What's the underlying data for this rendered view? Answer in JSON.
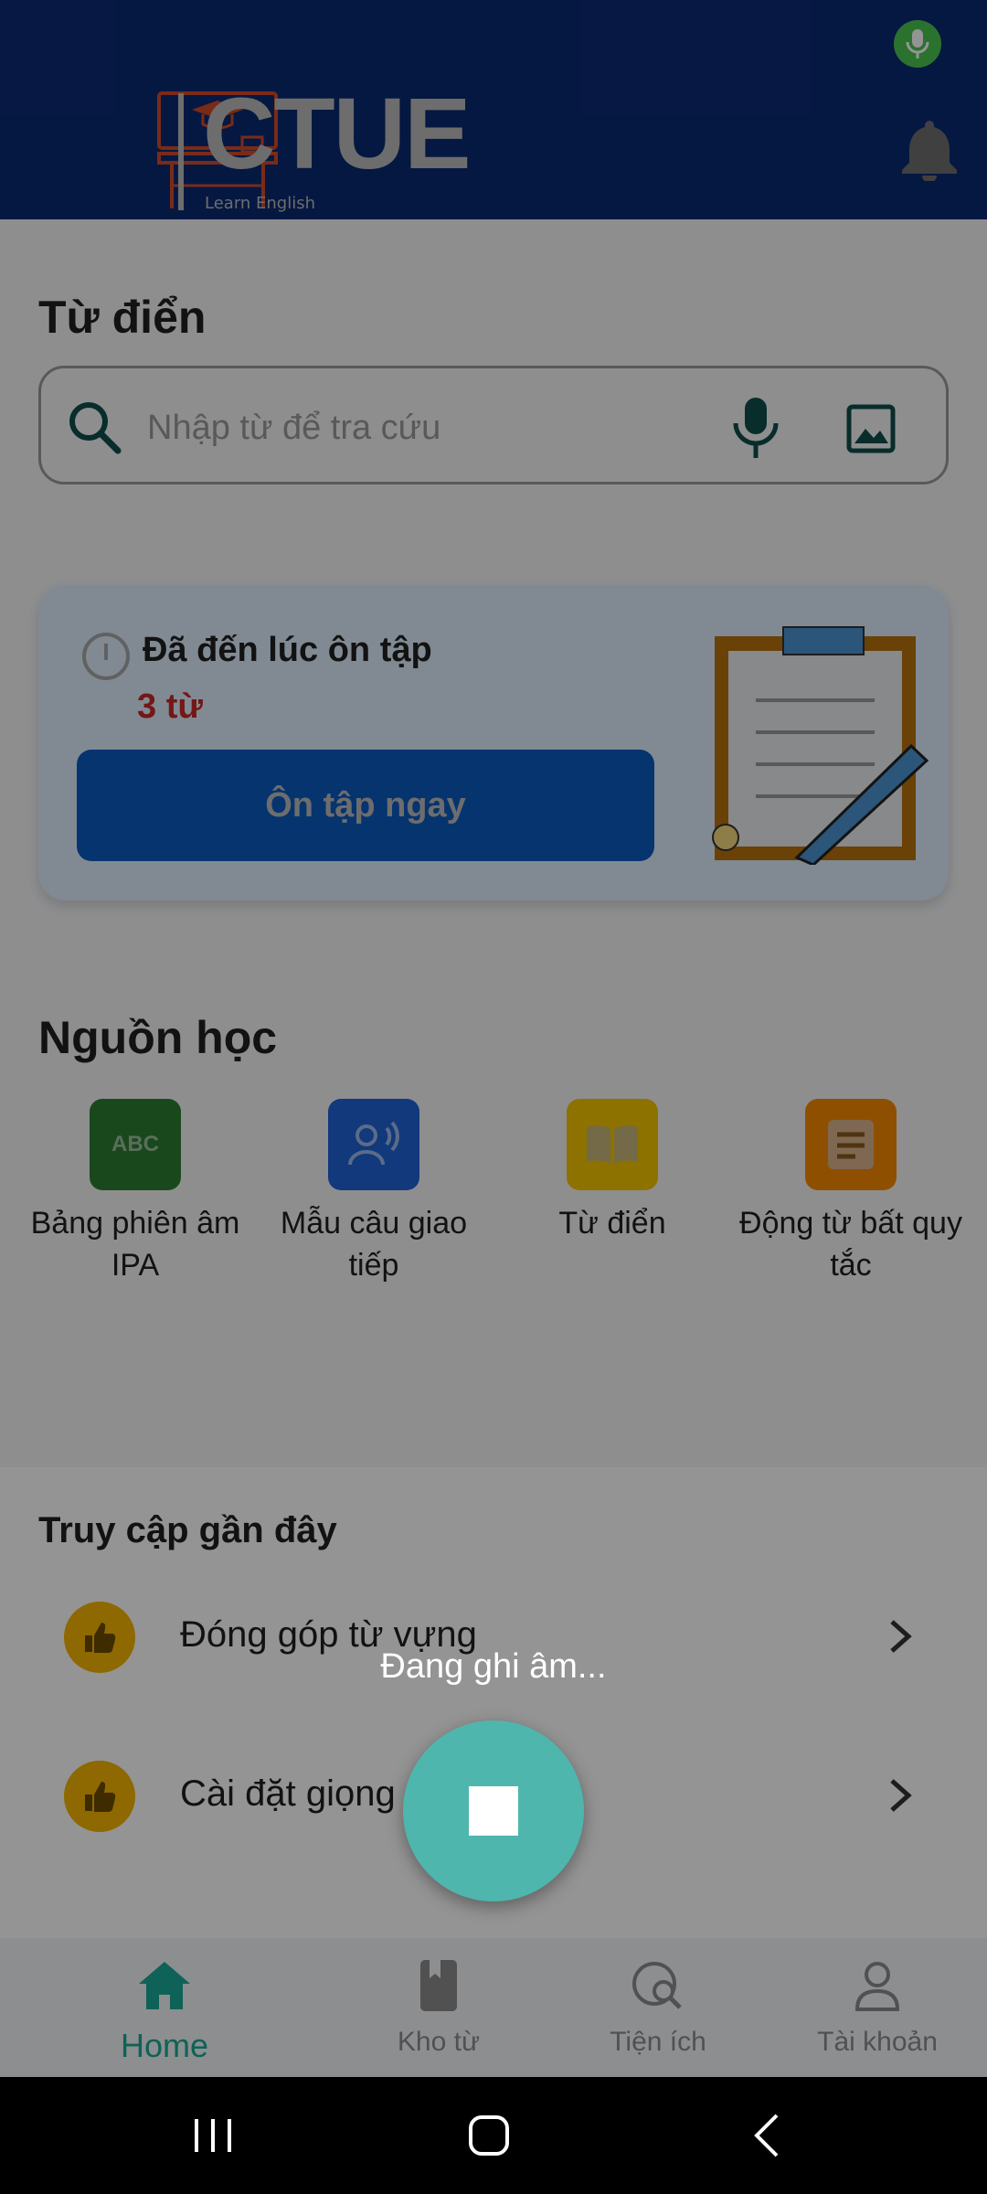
{
  "header": {
    "logo_text": "CTUE",
    "logo_subtitle": "Learn English",
    "notification_icon": "bell-icon",
    "recording_indicator_icon": "mic-icon"
  },
  "dictionary": {
    "title": "Từ điển",
    "search_placeholder": "Nhập từ để tra cứu",
    "search_icon": "search-icon",
    "voice_icon": "mic-icon",
    "image_icon": "image-icon"
  },
  "review_card": {
    "title": "Đã đến lúc ôn tập",
    "count": "3 từ",
    "button_label": "Ôn tập ngay"
  },
  "sources": {
    "title": "Nguồn học",
    "items": [
      {
        "label": "Bảng phiên âm IPA",
        "icon": "abc-icon",
        "color": "#2e7d32"
      },
      {
        "label": "Mẫu câu giao tiếp",
        "icon": "speaking-person-icon",
        "color": "#1e63d6"
      },
      {
        "label": "Từ điển",
        "icon": "book-icon",
        "color": "#f5c400"
      },
      {
        "label": "Động từ bất quy tắc",
        "icon": "document-icon",
        "color": "#f58a00"
      }
    ]
  },
  "recent": {
    "title": "Truy cập gần đây",
    "items": [
      {
        "label": "Đóng góp từ vựng",
        "icon": "thumbs-up-icon"
      },
      {
        "label": "Cài đặt giọng",
        "icon": "thumbs-up-icon"
      }
    ]
  },
  "recording": {
    "status_text": "Đang ghi âm...",
    "stop_icon": "stop-icon"
  },
  "bottom_nav": {
    "items": [
      {
        "label": "Home",
        "icon": "home-icon",
        "active": true
      },
      {
        "label": "Kho từ",
        "icon": "bookmark-book-icon",
        "active": false
      },
      {
        "label": "Tiện ích",
        "icon": "globe-search-icon",
        "active": false
      },
      {
        "label": "Tài khoản",
        "icon": "person-icon",
        "active": false
      }
    ]
  },
  "colors": {
    "header_bg": "#0a2a73",
    "primary_button": "#0b5bbf",
    "accent_teal": "#1aa997",
    "stop_button": "#4fb6ae",
    "count_red": "#c62828"
  }
}
